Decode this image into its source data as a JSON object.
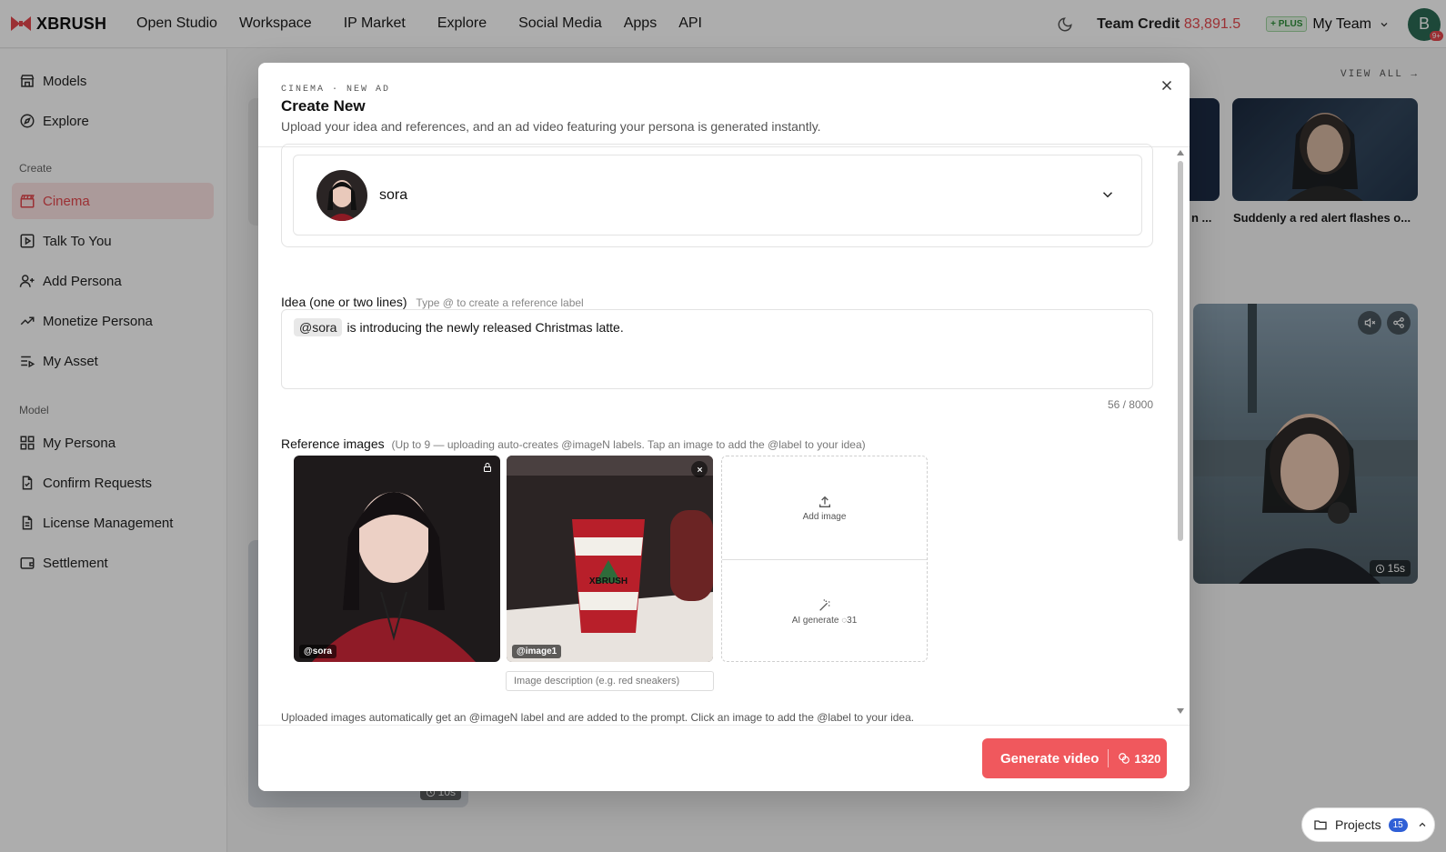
{
  "brand": {
    "name": "XBRUSH",
    "accent": "#e5484d"
  },
  "nav": [
    "Open Studio",
    "Workspace",
    "IP Market",
    "Explore",
    "Social Media",
    "Apps",
    "API"
  ],
  "header": {
    "credit_label": "Team Credit",
    "credit_value": "83,891.5",
    "plan_badge": "+ PLUS",
    "team_name": "My Team",
    "avatar_letter": "B",
    "avatar_badge": "9+"
  },
  "sidebar": {
    "top_items": [
      {
        "label": "Models",
        "icon": "store-icon"
      },
      {
        "label": "Explore",
        "icon": "compass-icon"
      }
    ],
    "create_section": "Create",
    "create_items": [
      {
        "label": "Cinema",
        "icon": "clapper-icon",
        "active": true
      },
      {
        "label": "Talk To You",
        "icon": "play-square-icon"
      },
      {
        "label": "Add Persona",
        "icon": "user-plus-icon"
      },
      {
        "label": "Monetize Persona",
        "icon": "trend-up-icon"
      },
      {
        "label": "My Asset",
        "icon": "list-play-icon"
      }
    ],
    "model_section": "Model",
    "model_items": [
      {
        "label": "My Persona",
        "icon": "grid-icon"
      },
      {
        "label": "Confirm Requests",
        "icon": "file-check-icon"
      },
      {
        "label": "License Management",
        "icon": "document-icon"
      },
      {
        "label": "Settlement",
        "icon": "wallet-icon"
      }
    ]
  },
  "background": {
    "view_all": "VIEW ALL",
    "captions": [
      "n ...",
      "Suddenly a red alert flashes o..."
    ],
    "durations": [
      "15s",
      "10s"
    ]
  },
  "projects": {
    "label": "Projects",
    "count": "15"
  },
  "modal": {
    "kicker": "CINEMA · NEW AD",
    "title": "Create New",
    "subtitle": "Upload your idea and references, and an ad video featuring your persona is generated instantly.",
    "persona_name": "sora",
    "idea_label": "Idea (one or two lines)",
    "idea_hint": "Type @ to create a reference label",
    "idea_tag": "@sora",
    "idea_text": "is introducing the newly released Christmas latte.",
    "idea_counter": "56 / 8000",
    "ref_label": "Reference images",
    "ref_hint": "(Up to 9 — uploading auto-creates @imageN labels. Tap an image to add the @label to your idea)",
    "ref_images": [
      {
        "tag": "@sora"
      },
      {
        "tag": "@image1"
      }
    ],
    "desc_placeholder": "Image description (e.g. red sneakers)",
    "add_image": "Add image",
    "ai_generate": "AI generate",
    "ai_cost": "31",
    "ref_footer": "Uploaded images automatically get an @imageN label and are added to the prompt. Click an image to add the @label to your idea.",
    "generate_label": "Generate video",
    "generate_cost": "1320"
  }
}
